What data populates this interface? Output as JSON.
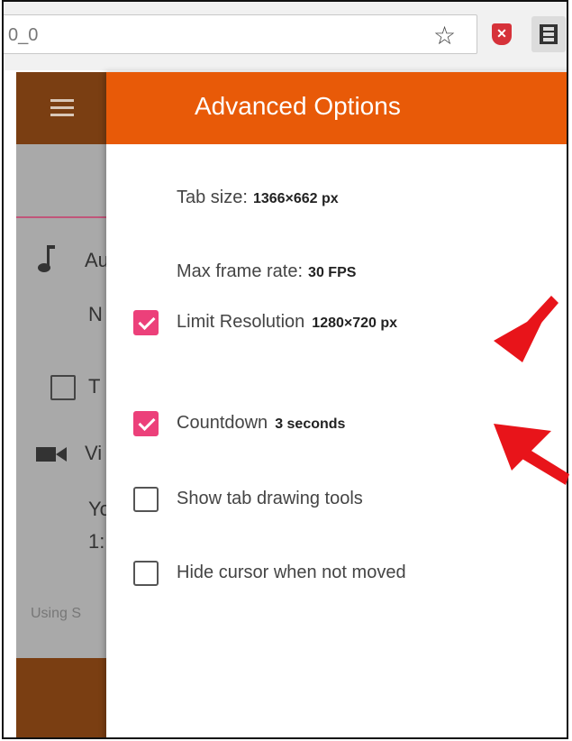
{
  "browser": {
    "url_fragment": "0_0",
    "star_icon": "star-icon",
    "extension_icons": [
      "shield-x-icon",
      "film-icon"
    ]
  },
  "background_app": {
    "partial_texts": [
      "Au",
      "N",
      "T",
      "Vi",
      "Yo",
      "1:",
      "Using S"
    ]
  },
  "dialog": {
    "title": "Advanced Options",
    "tab_size_label": "Tab size:",
    "tab_size_value": "1366×662 px",
    "max_frame_rate_label": "Max frame rate:",
    "max_frame_rate_value": "30 FPS",
    "options": [
      {
        "label": "Limit Resolution",
        "value": "1280×720 px",
        "checked": true
      },
      {
        "label": "Countdown",
        "value": "3 seconds",
        "checked": true
      },
      {
        "label": "Show tab drawing tools",
        "value": "",
        "checked": false
      },
      {
        "label": "Hide cursor when not moved",
        "value": "",
        "checked": false
      }
    ]
  },
  "colors": {
    "header_orange": "#e85a08",
    "checkbox_pink": "#ec407a",
    "annotation_red": "#e8141a"
  }
}
